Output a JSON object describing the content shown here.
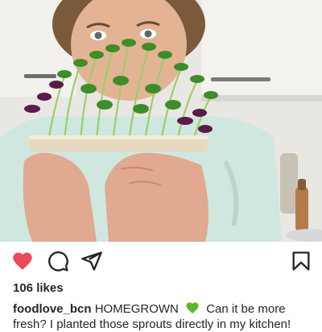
{
  "post": {
    "likes": "106 likes",
    "username": "foodlove_bcn",
    "caption_line1": "HOMEGROWN",
    "caption_line1_rest": "Can it be more",
    "caption_line2": "fresh? I planted those sprouts directly in my kitchen!",
    "emoji": "green-heart"
  },
  "icons": {
    "like": "heart-icon",
    "comment": "comment-icon",
    "share": "send-icon",
    "save": "bookmark-icon"
  },
  "colors": {
    "like_red": "#ed4956",
    "emoji_green": "#5cb82a",
    "text": "#262626"
  }
}
